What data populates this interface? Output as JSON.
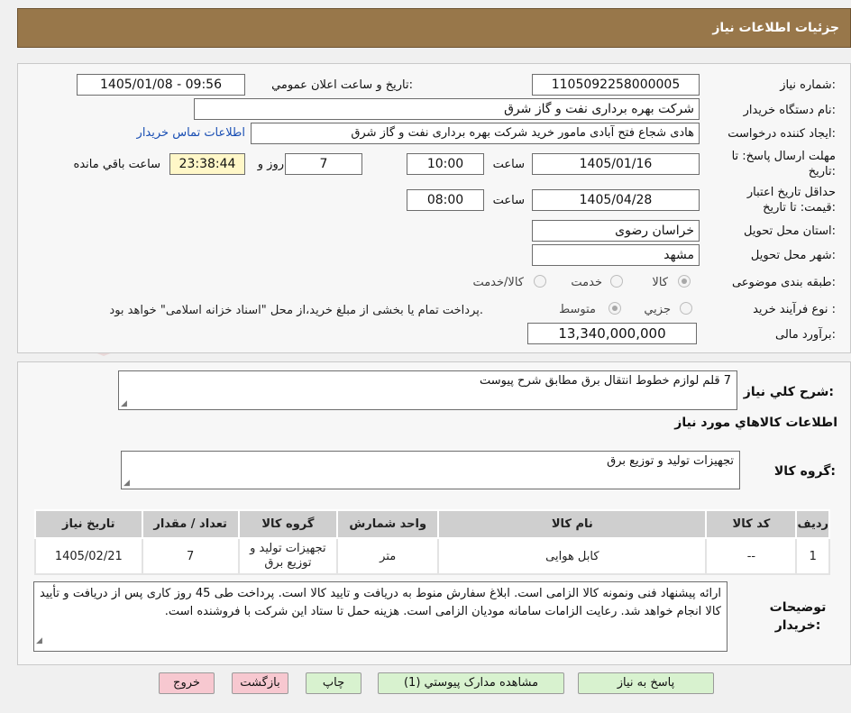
{
  "header": {
    "title": "جزئیات اطلاعات نیاز"
  },
  "watermark": {
    "text": "AriaTender.neT"
  },
  "fields": {
    "need_number_label": "شماره نیاز:",
    "need_number": "1105092258000005",
    "announce_label": "تاریخ و ساعت اعلان عمومي:",
    "announce_value": "1405/01/08 - 09:56",
    "buyer_org_label": "نام دستگاه خريدار:",
    "buyer_org": "شرکت بهره برداری نفت و گاز شرق",
    "creator_label": "ایجاد کننده درخواست:",
    "creator": "هادی شجاع فتح آبادی مامور خرید شرکت بهره برداری نفت و گاز شرق",
    "contact_link": "اطلاعات تماس خریدار",
    "reply_deadline_label": "مهلت ارسال پاسخ: تا تاریخ:",
    "reply_date": "1405/01/16",
    "hour_label": "ساعت",
    "reply_time": "10:00",
    "days": "7",
    "days_label": "روز و",
    "remaining_time": "23:38:44",
    "remaining_label": "ساعت باقي مانده",
    "validity_label": "حداقل تاریخ اعتبار قیمت: تا تاریخ:",
    "validity_date": "1405/04/28",
    "validity_hour_label": "ساعت",
    "validity_time": "08:00",
    "province_label": "استان محل تحویل:",
    "province": "خراسان رضوی",
    "city_label": "شهر محل تحویل:",
    "city": "مشهد",
    "category_label": "طبقه بندی موضوعی:",
    "category_options": [
      "کالا",
      "خدمت",
      "کالا/خدمت"
    ],
    "process_label": "نوع فرآیند خرید :",
    "process_options": [
      "جزیي",
      "متوسط"
    ],
    "process_note": "پرداخت تمام یا بخشی از مبلغ خرید،از محل \"اسناد خزانه اسلامی\" خواهد بود.",
    "budget_label": "برآورد مالی:",
    "budget": "13,340,000,000"
  },
  "description": {
    "label": "شرح کلي نياز:",
    "value": "7 قلم لوازم خطوط انتقال برق مطابق شرح پیوست"
  },
  "goods": {
    "section_title": "اطلاعات کالاهاي مورد نياز",
    "group_label": "گروه کالا:",
    "group_value": "تجهیزات تولید و توزیع برق",
    "columns": [
      "ردیف",
      "کد کالا",
      "نام کالا",
      "واحد شمارش",
      "گروه کالا",
      "تعداد / مقدار",
      "تاریخ نیاز"
    ],
    "rows": [
      {
        "row": "1",
        "code": "--",
        "name": "کابل هوایی",
        "unit": "متر",
        "group": "تجهیزات تولید و توزیع برق",
        "qty": "7",
        "date": "1405/02/21"
      }
    ]
  },
  "buyer_notes": {
    "label": "توضیحات خریدار:",
    "value": "ارائه پیشنهاد فنی ونمونه کالا الزامی است. ابلاغ سفارش منوط به دریافت و تایید کالا است. پرداخت طی  45 روز کاری پس از دریافت و تأیید کالا انجام خواهد شد. رعایت الزامات سامانه مودیان الزامی است. هزینه حمل تا ستاد این شرکت با فروشنده است."
  },
  "buttons": {
    "reply": "پاسخ به نیاز",
    "attachments": "مشاهده مدارک پیوستي (1)",
    "print": "چاپ",
    "back": "بازگشت",
    "exit": "خروج"
  },
  "colors": {
    "header_bg": "#98774a",
    "time_bg": "#fff7c8",
    "link": "#1a4fb4",
    "btn_green": "#d8f2cf",
    "btn_pink": "#f7c8d0"
  }
}
